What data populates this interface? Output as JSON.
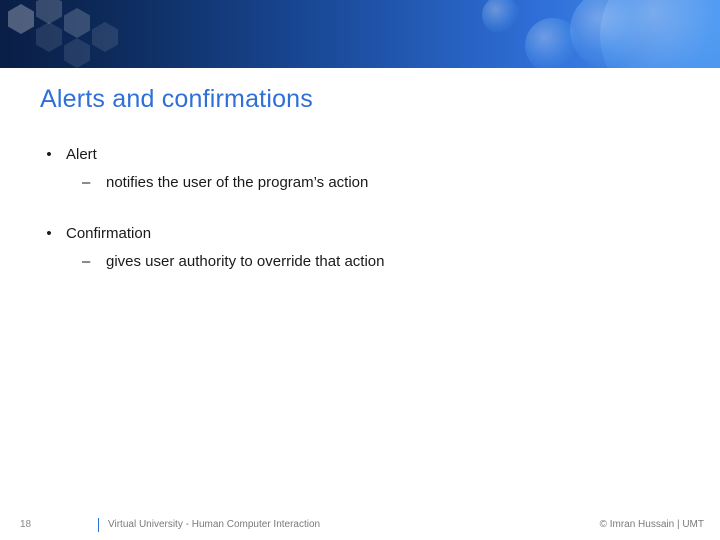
{
  "title": "Alerts and confirmations",
  "items": [
    {
      "label": "Alert",
      "sub": "notifies the user of the program’s action"
    },
    {
      "label": "Confirmation",
      "sub": "gives user authority to override that action"
    }
  ],
  "footer": {
    "page_number": "18",
    "center": "Virtual University - Human Computer Interaction",
    "right": "© Imran Hussain | UMT"
  }
}
